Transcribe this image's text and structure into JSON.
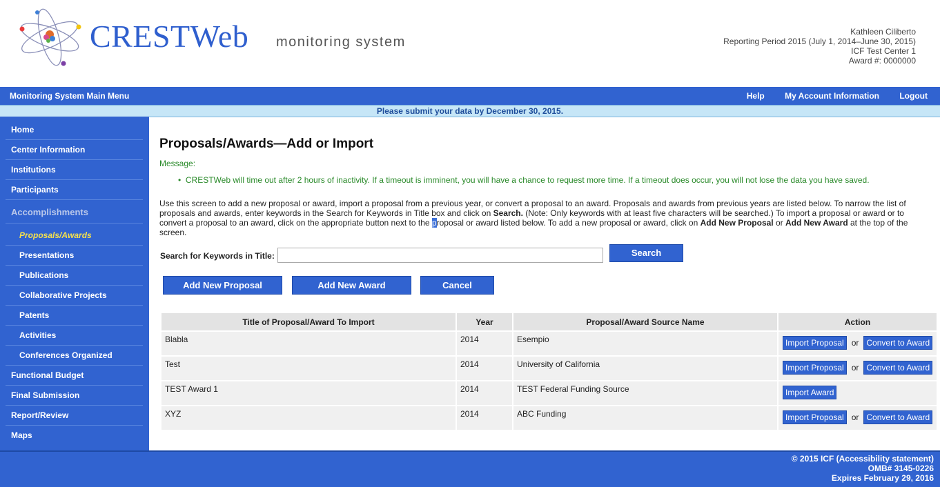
{
  "header": {
    "brand": "CRESTWeb",
    "tagline": "monitoring system",
    "user": {
      "name": "Kathleen Ciliberto",
      "period": "Reporting Period 2015 (July 1, 2014–June 30, 2015)",
      "center": "ICF Test Center 1",
      "award": "Award #: 0000000"
    }
  },
  "topnav": {
    "main": "Monitoring System Main Menu",
    "help": "Help",
    "account": "My Account Information",
    "logout": "Logout"
  },
  "notice": "Please submit your data by December 30, 2015.",
  "sidebar": {
    "items": [
      "Home",
      "Center Information",
      "Institutions",
      "Participants",
      "Accomplishments",
      "Proposals/Awards",
      "Presentations",
      "Publications",
      "Collaborative Projects",
      "Patents",
      "Activities",
      "Conferences Organized",
      "Functional Budget",
      "Final Submission",
      "Report/Review",
      "Maps"
    ]
  },
  "main": {
    "title": "Proposals/Awards—Add or Import",
    "message_label": "Message:",
    "message": "CRESTWeb will time out after 2 hours of inactivity. If a timeout is imminent, you will have a chance to request more time. If a timeout does occur, you will not lose the data you have saved.",
    "intro": {
      "p1": "Use this screen to add a new proposal or award, import a proposal from a previous year, or convert a proposal to an award. Proposals and awards from previous years are listed below. To narrow the list of proposals and awards, enter keywords in the Search for Keywords in Title box and click on ",
      "b1": "Search.",
      "p2": " (Note: Only keywords with at least five characters will be searched.) To import a proposal or award or to convert a proposal to an award, click on the appropriate button next to the ",
      "cursor": "p",
      "p3": "roposal or award listed below. To add a new proposal or award, click on ",
      "b2": "Add New Proposal",
      "p4": " or ",
      "b3": "Add New Award",
      "p5": " at the top of the screen."
    },
    "search_label": "Search for Keywords in Title:",
    "search_value": "",
    "search_button": "Search",
    "add_proposal": "Add New Proposal",
    "add_award": "Add New Award",
    "cancel": "Cancel",
    "table": {
      "headers": [
        "Title of Proposal/Award To Import",
        "Year",
        "Proposal/Award Source Name",
        "Action"
      ],
      "rows": [
        {
          "title": "Blabla",
          "year": "2014",
          "source": "Esempio"
        },
        {
          "title": "Test",
          "year": "2014",
          "source": "University of California"
        },
        {
          "title": "TEST Award 1",
          "year": "2014",
          "source": "TEST Federal Funding Source"
        },
        {
          "title": "XYZ",
          "year": "2014",
          "source": "ABC Funding"
        }
      ],
      "import_proposal": "Import Proposal",
      "or": "or",
      "convert": "Convert to Award",
      "import_award": "Import Award"
    }
  },
  "footer": {
    "line1": "© 2015 ICF (Accessibility statement)",
    "line2": "OMB# 3145-0226",
    "line3": "Expires February 29, 2016"
  }
}
